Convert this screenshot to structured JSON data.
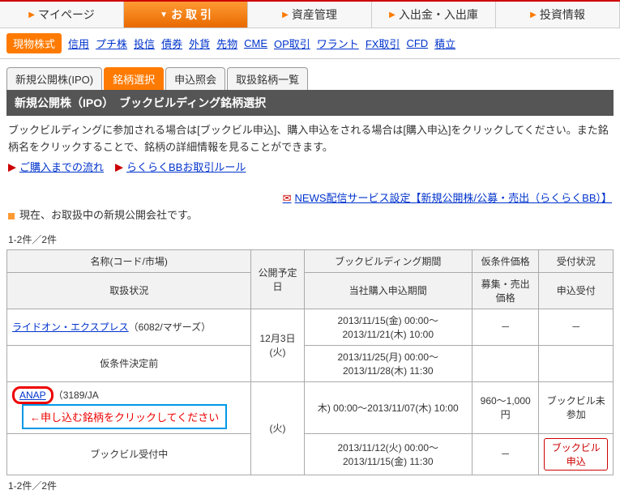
{
  "topnav": {
    "items": [
      "マイページ",
      "お 取 引",
      "資産管理",
      "入出金・入出庫",
      "投資情報"
    ],
    "active": 1
  },
  "subnav": {
    "pill": "現物株式",
    "items": [
      "信用",
      "プチ株",
      "投信",
      "債券",
      "外貨",
      "先物",
      "CME",
      "OP取引",
      "ワラント",
      "FX取引",
      "CFD",
      "積立"
    ]
  },
  "tabs": {
    "items": [
      "新規公開株(IPO)",
      "銘柄選択",
      "申込照会",
      "取扱銘柄一覧"
    ],
    "active": 1
  },
  "titlebar": "新規公開株（IPO）　ブックビルディング銘柄選択",
  "intro": "ブックビルディングに参加される場合は[ブックビル申込]、購入申込をされる場合は[購入申込]をクリックしてください。また銘柄名をクリックすることで、銘柄の詳細情報を見ることができます。",
  "links": {
    "flow": "ご購入までの流れ",
    "rule": "らくらくBBお取引ルール"
  },
  "news": "NEWS配信サービス設定【新規公開株/公募・売出（らくらくBB）】",
  "current": "現在、お取扱中の新規公開会社です。",
  "count": "1-2件／2件",
  "table": {
    "headers": {
      "name": "名称(コード/市場)",
      "date": "公開予定日",
      "bb_period": "ブックビルディング期間",
      "prov_price": "仮条件価格",
      "recv": "受付状況",
      "status": "取扱状況",
      "buy_period": "当社購入申込期間",
      "offer_price": "募集・売出価格",
      "apply": "申込受付"
    },
    "rows": [
      {
        "name_link": "ライドオン・エクスプレス",
        "name_rest": "（6082/マザーズ）",
        "date": "12月3日(火)",
        "bb_period": "2013/11/15(金) 00:00～2013/11/21(木) 10:00",
        "prov": "－",
        "recv": "－",
        "status": "仮条件決定前",
        "buy_period": "2013/11/25(月) 00:00～2013/11/28(木) 11:30",
        "offer": "",
        "apply": ""
      },
      {
        "name_link": "ANAP",
        "name_rest": "（3189/JA",
        "annotation": "←申し込む銘柄をクリックしてください",
        "date_hidden": "(火)",
        "bb_period": "木) 00:00～2013/11/07(木) 10:00",
        "prov": "960～1,000円",
        "recv": "ブックビル未参加",
        "status": "ブックビル受付中",
        "buy_period": "2013/11/12(火) 00:00～2013/11/15(金) 11:30",
        "offer": "－",
        "apply_btn": "ブックビル申込"
      }
    ]
  }
}
